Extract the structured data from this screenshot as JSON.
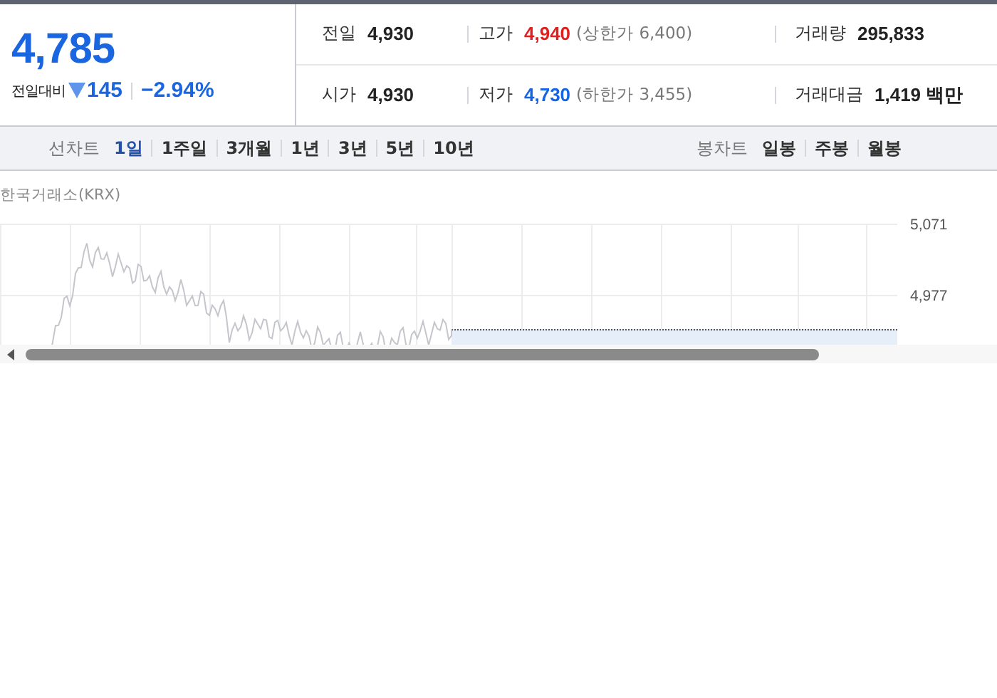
{
  "quote": {
    "price": "4,785",
    "change_label": "전일대비",
    "color": "#1a66e0",
    "change": "145",
    "change_rate": "−2.94%"
  },
  "stats": [
    {
      "label": "전일",
      "value": "4,930",
      "color": "#222222"
    },
    {
      "label": "고가",
      "value": "4,940",
      "color": "#e0201e",
      "note": "(상한가 6,400)"
    },
    {
      "label": "거래량",
      "value": "295,833",
      "color": "#222222"
    },
    {
      "label": "시가",
      "value": "4,930",
      "color": "#222222"
    },
    {
      "label": "저가",
      "value": "4,730",
      "color": "#1464e4",
      "note": "(하한가 3,455)"
    },
    {
      "label": "거래대금",
      "value": "1,419 백만",
      "color": "#222222"
    }
  ],
  "line_chart": {
    "label": "선차트",
    "periods": [
      {
        "label": "1일",
        "selected": true
      },
      {
        "label": "1주일",
        "selected": false
      },
      {
        "label": "3개월",
        "selected": false
      },
      {
        "label": "1년",
        "selected": false
      },
      {
        "label": "3년",
        "selected": false
      },
      {
        "label": "5년",
        "selected": false
      },
      {
        "label": "10년",
        "selected": false
      }
    ]
  },
  "candle_chart": {
    "label": "봉차트",
    "periods": [
      {
        "label": "일봉",
        "selected": false
      },
      {
        "label": "주봉",
        "selected": false
      },
      {
        "label": "월봉",
        "selected": false
      }
    ]
  },
  "chart": {
    "source": "한국거래소(KRX)",
    "y_tick_labels": [
      "5,071",
      "4,977"
    ]
  }
}
